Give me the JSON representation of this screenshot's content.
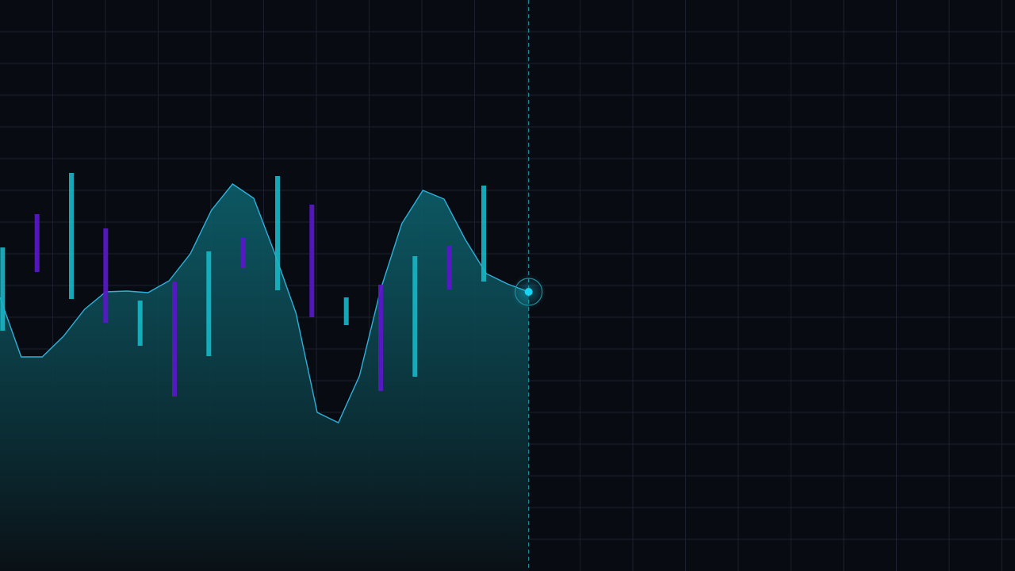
{
  "colors": {
    "background": "#090b12",
    "grid": "#1a2030",
    "area_top": "#0d6470",
    "area_bottom": "#0a1116",
    "line": "#2fb0d8",
    "bar_up": "#17b5c4",
    "bar_down": "#5a18c9",
    "cursor": "#1e8e9c",
    "marker": "#19d3f0"
  },
  "chart_data": {
    "type": "line",
    "grid": true,
    "legend": "none",
    "xlim": [
      0,
      19.2
    ],
    "ylim": [
      0,
      720
    ],
    "area_fill": true,
    "cursor_x": 10,
    "series": [
      {
        "x": [
          0,
          0.4,
          0.8,
          1.2,
          1.6,
          2.0,
          2.4,
          2.8,
          3.2,
          3.6,
          4.0,
          4.4,
          4.8,
          5.2,
          5.6,
          6.0,
          6.4,
          6.8,
          7.2,
          7.6,
          8.0,
          8.4,
          8.8,
          9.2,
          9.6,
          10.0
        ],
        "values": [
          345,
          270,
          270,
          296,
          330,
          352,
          353,
          351,
          366,
          400,
          455,
          488,
          470,
          400,
          325,
          200,
          187,
          246,
          355,
          438,
          480,
          469,
          418,
          375,
          362,
          352
        ]
      },
      {
        "type": "bar_range",
        "x": [
          0.05,
          0.7,
          1.35,
          2.0,
          2.65,
          3.3,
          3.95,
          4.6,
          5.25,
          5.9,
          6.55,
          7.2,
          7.85,
          8.5,
          9.15
        ],
        "low": [
          303,
          377,
          343,
          313,
          284,
          220,
          271,
          382,
          354,
          320,
          310,
          227,
          245,
          355,
          365
        ],
        "high": [
          408,
          450,
          502,
          432,
          341,
          365,
          403,
          420,
          498,
          462,
          345,
          361,
          397,
          410,
          486
        ],
        "direction": [
          "up",
          "down",
          "up",
          "down",
          "up",
          "down",
          "up",
          "down",
          "up",
          "down",
          "up",
          "down",
          "up",
          "down",
          "up"
        ]
      }
    ]
  }
}
